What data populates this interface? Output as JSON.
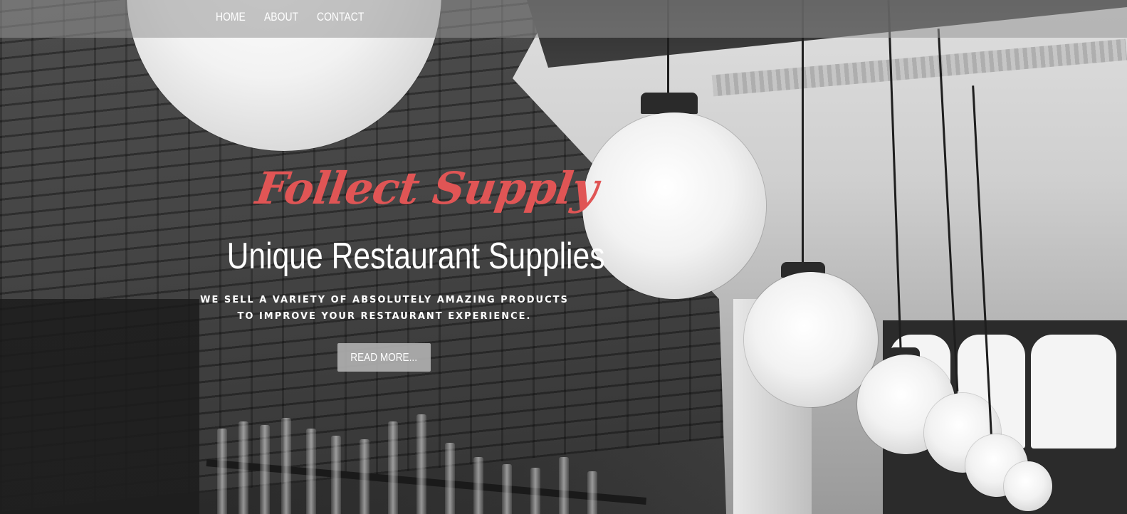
{
  "nav": {
    "items": [
      {
        "label": "HOME"
      },
      {
        "label": "ABOUT"
      },
      {
        "label": "CONTACT"
      }
    ]
  },
  "hero": {
    "brand": "Follect Supply",
    "headline": "Unique Restaurant Supplies",
    "tagline_line1": "WE SELL A VARIETY OF ABSOLUTELY AMAZING PRODUCTS",
    "tagline_line2": "TO IMPROVE YOUR RESTAURANT EXPERIENCE.",
    "cta_label": "READ MORE..."
  },
  "colors": {
    "brand_accent": "#e05555",
    "nav_bg": "rgba(150,150,150,0.55)",
    "button_bg": "#afafaf",
    "text": "#ffffff"
  }
}
